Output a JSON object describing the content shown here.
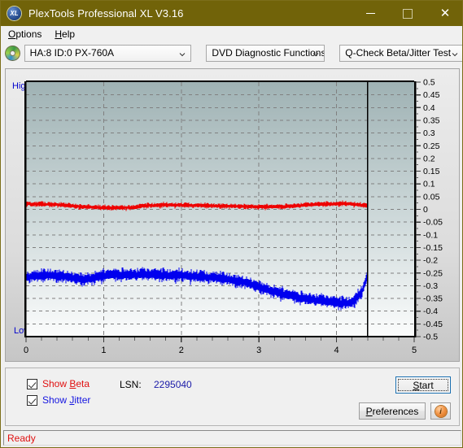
{
  "window": {
    "title": "PlexTools Professional XL V3.16",
    "icon": "XL",
    "minimize_label": "Minimize",
    "maximize_label": "Maximize",
    "close_label": "Close"
  },
  "menu": {
    "items": [
      {
        "label": "Options",
        "accel": "O"
      },
      {
        "label": "Help",
        "accel": "H"
      }
    ]
  },
  "toolbar": {
    "drive_icon": "disc-icon",
    "drive": "HA:8 ID:0  PX-760A",
    "function": "DVD Diagnostic Functions",
    "test": "Q-Check Beta/Jitter Test"
  },
  "chart_panel": {
    "label_high": "High",
    "label_low": "Low"
  },
  "controls": {
    "show_beta_label": "Show Beta",
    "show_beta_accel": "B",
    "show_beta_checked": true,
    "show_jitter_label": "Show Jitter",
    "show_jitter_accel": "J",
    "show_jitter_checked": true,
    "lsn_label": "LSN:",
    "lsn_value": "2295040",
    "start_label": "Start",
    "start_accel": "S",
    "preferences_label": "Preferences",
    "preferences_accel": "P",
    "info_label": "i"
  },
  "status": {
    "text": "Ready"
  },
  "colors": {
    "titlebar": "#716309",
    "beta_series": "#ee0000",
    "jitter_series": "#0000ee",
    "axis_text": "#000000",
    "axis_label": "#0000cc",
    "status_text": "#e01010",
    "lsn_value": "#1a1aa8",
    "plot_bg_top": "#9fb2b4",
    "plot_bg_bottom": "#fbfcfc",
    "grid": "#808080"
  },
  "chart_data": {
    "type": "line",
    "title": "Q-Check Beta/Jitter Test",
    "xlabel": "",
    "ylabel": "",
    "xlim": [
      0,
      5
    ],
    "ylim": [
      -0.5,
      0.5
    ],
    "x_ticks": [
      0,
      1,
      2,
      3,
      4,
      5
    ],
    "x_tick_labels": [
      "0",
      "1",
      "2",
      "3",
      "4",
      "5"
    ],
    "x_minor_ticks_per_major": 5,
    "y_ticks": [
      0.5,
      0.45,
      0.4,
      0.35,
      0.3,
      0.25,
      0.2,
      0.15,
      0.1,
      0.05,
      0,
      -0.05,
      -0.1,
      -0.15,
      -0.2,
      -0.25,
      -0.3,
      -0.35,
      -0.4,
      -0.45,
      -0.5
    ],
    "y_tick_labels": [
      "0.5",
      "0.45",
      "0.4",
      "0.35",
      "0.3",
      "0.25",
      "0.2",
      "0.15",
      "0.1",
      "0.05",
      "0",
      "-0.05",
      "-0.1",
      "-0.15",
      "-0.2",
      "-0.25",
      "-0.3",
      "-0.35",
      "-0.4",
      "-0.45",
      "-0.5"
    ],
    "grid": true,
    "grid_style": "dashed",
    "grid_x_major": [
      1,
      2,
      3,
      4
    ],
    "left_axis_label": "High",
    "left_axis_label_bottom": "Low",
    "data_end_marker_x": 4.4,
    "noise_band": true,
    "series": [
      {
        "name": "Beta",
        "color": "#ee0000",
        "noise_amplitude": 0.012,
        "x": [
          0.0,
          0.15,
          0.3,
          0.45,
          0.6,
          0.75,
          0.9,
          1.05,
          1.2,
          1.35,
          1.5,
          1.65,
          1.8,
          1.95,
          2.1,
          2.25,
          2.4,
          2.55,
          2.7,
          2.85,
          3.0,
          3.15,
          3.3,
          3.45,
          3.6,
          3.75,
          3.9,
          4.05,
          4.2,
          4.35,
          4.4
        ],
        "values": [
          0.022,
          0.021,
          0.02,
          0.018,
          0.013,
          0.01,
          0.008,
          0.006,
          0.006,
          0.007,
          0.014,
          0.016,
          0.017,
          0.017,
          0.016,
          0.015,
          0.014,
          0.013,
          0.012,
          0.011,
          0.01,
          0.01,
          0.011,
          0.014,
          0.017,
          0.02,
          0.021,
          0.022,
          0.021,
          0.016,
          0.014
        ]
      },
      {
        "name": "Jitter",
        "color": "#0000ee",
        "noise_amplitude": 0.03,
        "x": [
          0.0,
          0.15,
          0.3,
          0.45,
          0.6,
          0.75,
          0.9,
          1.05,
          1.2,
          1.35,
          1.5,
          1.65,
          1.8,
          1.95,
          2.1,
          2.25,
          2.4,
          2.55,
          2.7,
          2.85,
          3.0,
          3.15,
          3.3,
          3.45,
          3.6,
          3.75,
          3.9,
          4.05,
          4.2,
          4.32,
          4.4
        ],
        "values": [
          -0.265,
          -0.262,
          -0.258,
          -0.262,
          -0.27,
          -0.276,
          -0.268,
          -0.258,
          -0.256,
          -0.256,
          -0.255,
          -0.256,
          -0.258,
          -0.26,
          -0.262,
          -0.264,
          -0.268,
          -0.272,
          -0.28,
          -0.29,
          -0.305,
          -0.32,
          -0.332,
          -0.342,
          -0.35,
          -0.356,
          -0.362,
          -0.368,
          -0.366,
          -0.33,
          -0.262
        ]
      }
    ]
  }
}
